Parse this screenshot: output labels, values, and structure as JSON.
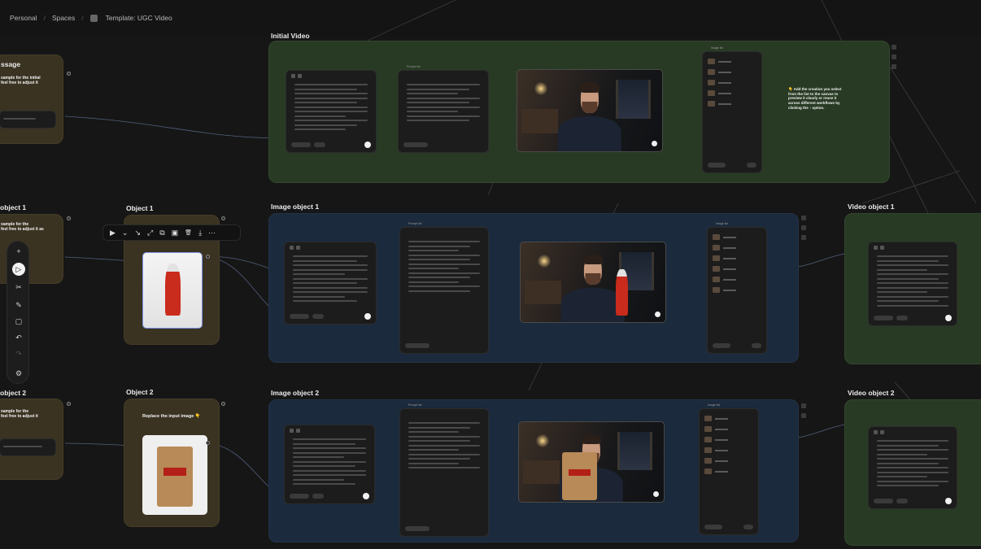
{
  "breadcrumb": {
    "personal": "Personal",
    "spaces": "Spaces",
    "template": "Template: UGC Video"
  },
  "groups": {
    "initial_video": "Initial Video",
    "image_object_1": "Image object 1",
    "image_object_2": "Image object 2",
    "video_object_1": "Video object 1",
    "video_object_2": "Video object 2",
    "object_1": "Object 1",
    "object_2": "Object 2",
    "left_message": "ssage",
    "left_object_1": "object 1",
    "left_object_2": "object 2"
  },
  "notes": {
    "left_message_body": "xample for the initial\nfeel free to adjust it",
    "left_object_1_body": "xample for the\nfeel free to adjust it as",
    "left_object_2_body": "xample for the\nfeel free to adjust it",
    "replace_input": "Replace the input image 👇",
    "add_creation": "👇 Add the creation you select\nfrom the list to the canvas to\npreview it clearly or reuse it\nacross different workflows by\nclicking the ↑ option."
  },
  "labels": {
    "prompt_list": "Prompt list",
    "image_list": "Image list",
    "video": "Video"
  },
  "toolbar": {
    "add": "+",
    "pointer": "▷",
    "scissors": "✂",
    "pen": "✎",
    "comment": "▢",
    "undo": "↶",
    "redo": "↷",
    "settings": "⚙"
  },
  "node_toolbar": {
    "play": "▶",
    "chev": "⌄",
    "connect": "↘",
    "expand": "⤢",
    "copy": "⧉",
    "image": "▣",
    "trash": "🗑",
    "download": "⤓",
    "more": "⋯"
  },
  "colors": {
    "green_group": "#283a24",
    "blue_group": "#1b2a3c",
    "olive_group": "#3a3322",
    "background": "#161616"
  }
}
